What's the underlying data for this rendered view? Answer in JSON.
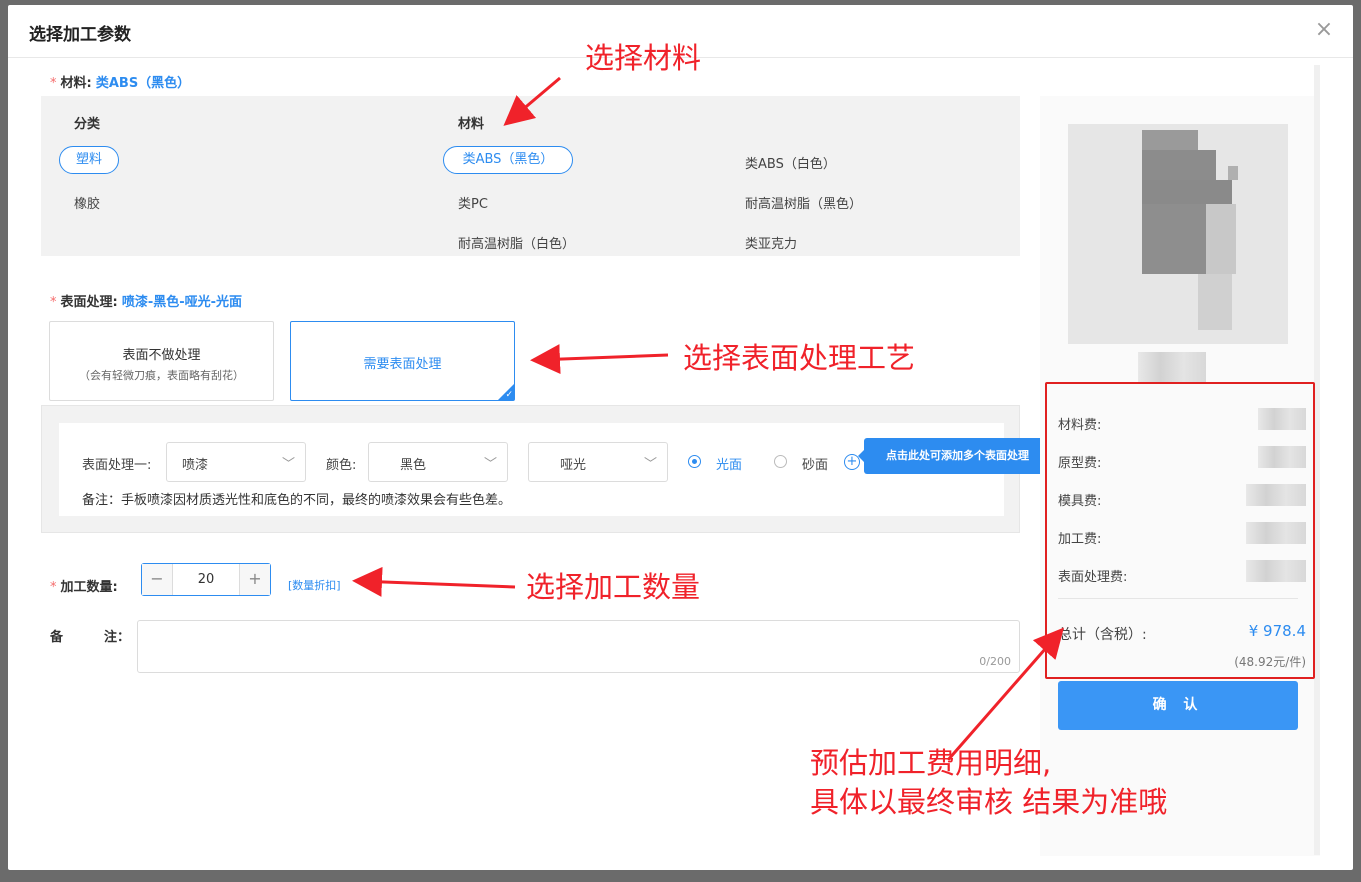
{
  "dialog": {
    "title": "选择加工参数",
    "close_symbol": "×"
  },
  "material": {
    "label": "材料:",
    "selected": "类ABS（黑色）",
    "category_header": "分类",
    "material_header": "材料",
    "categories": [
      "塑料",
      "橡胶"
    ],
    "items": [
      "类ABS（黑色）",
      "类ABS（白色）",
      "类PC",
      "耐高温树脂（黑色）",
      "耐高温树脂（白色）",
      "类亚克力"
    ]
  },
  "surface": {
    "label": "表面处理:",
    "selected": "喷漆-黑色-哑光-光面",
    "cards": [
      {
        "title": "表面不做处理",
        "subtitle": "（会有轻微刀痕，表面略有刮花）"
      },
      {
        "title": "需要表面处理",
        "subtitle": ""
      }
    ],
    "options": {
      "process_label": "表面处理一:",
      "process_value": "喷漆",
      "color_label": "颜色:",
      "color_value": "黑色",
      "finish_value": "哑光",
      "radio_glossy": "光面",
      "radio_sand": "砂面",
      "note": "备注：手板喷漆因材质透光性和底色的不同，最终的喷漆效果会有些色差。",
      "add_tooltip": "点击此处可添加多个表面处理"
    }
  },
  "quantity": {
    "label": "加工数量:",
    "value": "20",
    "minus": "−",
    "plus": "+",
    "discount_link": "[数量折扣]"
  },
  "remark": {
    "label_a": "备",
    "label_b": "注：",
    "counter": "0/200"
  },
  "costs": {
    "rows": [
      "材料费:",
      "原型费:",
      "模具费:",
      "加工费:",
      "表面处理费:"
    ],
    "total_label": "总计（含税）:",
    "total_value": "¥ 978.4",
    "per_unit": "(48.92元/件)",
    "confirm_label": "确 认"
  },
  "annotations": {
    "select_material": "选择材料",
    "select_surface": "选择表面处理工艺",
    "select_quantity": "选择加工数量",
    "estimate_line1": "预估加工费用明细,",
    "estimate_line2": "具体以最终审核 结果为准哦"
  },
  "colors": {
    "accent": "#2d8cf0",
    "annotation_red": "#f0222a",
    "confirm_button": "#3a96f5"
  }
}
